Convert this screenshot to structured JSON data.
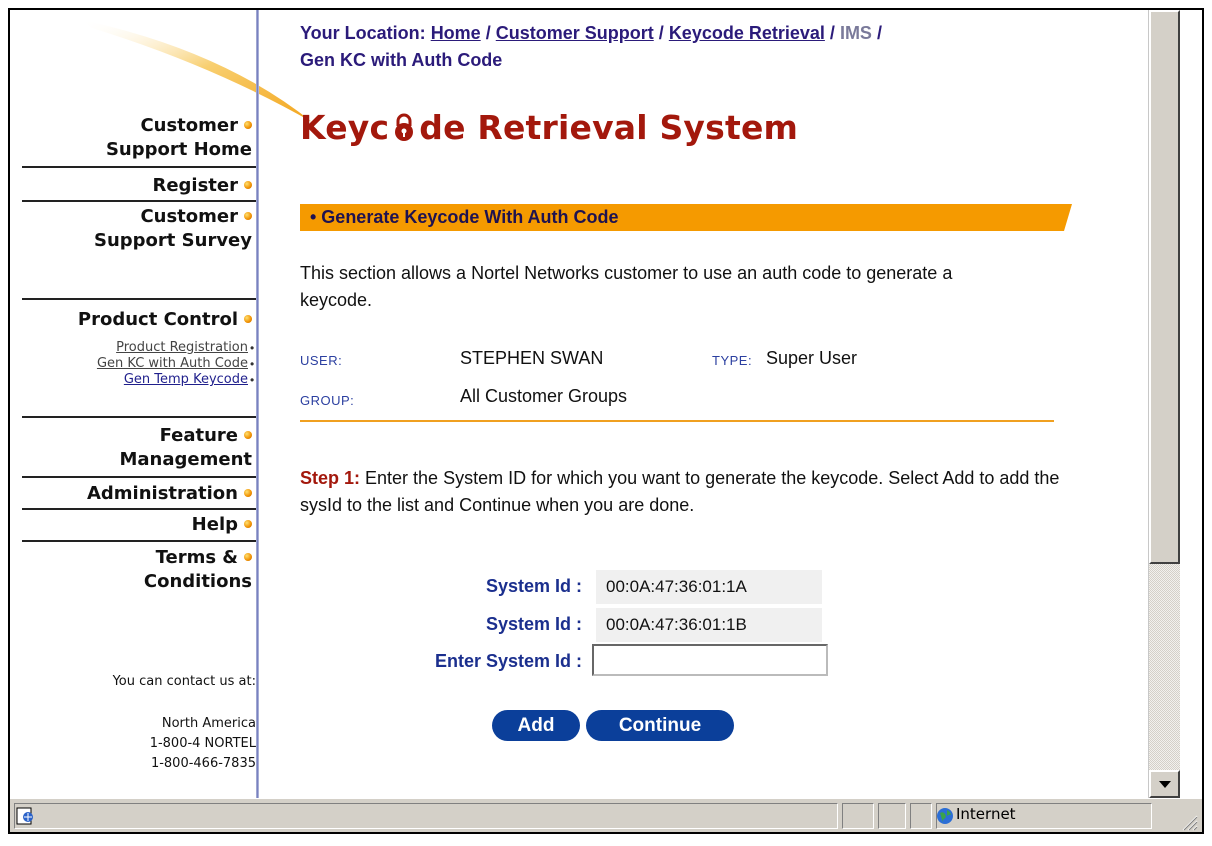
{
  "breadcrumb": {
    "prefix": "Your Location:",
    "items": [
      "Home",
      "Customer Support",
      "Keycode Retrieval",
      "IMS",
      "Gen KC with Auth Code"
    ],
    "separator": "/"
  },
  "page": {
    "title_before": "Keyc",
    "title_after": "de Retrieval System",
    "section_title": "• Generate Keycode With Auth Code",
    "intro": "This section allows a Nortel Networks customer to use an auth code to generate a keycode."
  },
  "user_info": {
    "user_label": "USER:",
    "user_value": "STEPHEN SWAN",
    "type_label": "TYPE:",
    "type_value": "Super User",
    "group_label": "GROUP:",
    "group_value": "All Customer Groups"
  },
  "step": {
    "label": "Step 1:",
    "text": " Enter the System ID for which you want to generate the keycode. Select Add to add the sysId to the list and Continue when you are done."
  },
  "system_ids": {
    "label": "System Id :",
    "values": [
      "00:0A:47:36:01:1A",
      "00:0A:47:36:01:1B"
    ],
    "enter_label": "Enter System Id :",
    "input_value": ""
  },
  "buttons": {
    "add": "Add",
    "continue": "Continue"
  },
  "sidebar": {
    "items": [
      {
        "label_line1": "Customer",
        "label_line2": "Support Home"
      },
      {
        "label_line1": "Register"
      },
      {
        "label_line1": "Customer",
        "label_line2": "Support Survey"
      },
      {
        "label_line1": "Product Control"
      },
      {
        "label_line1": "Feature",
        "label_line2": "Management"
      },
      {
        "label_line1": "Administration"
      },
      {
        "label_line1": "Help"
      },
      {
        "label_line1": "Terms &",
        "label_line2": "Conditions"
      }
    ],
    "sub_links": [
      "Product Registration",
      "Gen KC with Auth Code",
      "Gen Temp Keycode"
    ],
    "contact": {
      "intro": "You can contact us at:",
      "region": "North America",
      "phone1": "1-800-4 NORTEL",
      "phone2": "1-800-466-7835"
    }
  },
  "statusbar": {
    "text": "",
    "zone": "Internet"
  },
  "colors": {
    "accent_orange": "#f59a00",
    "title_red": "#a3180c",
    "button_blue": "#0b3f9a",
    "link_navy": "#2b1b7a"
  }
}
